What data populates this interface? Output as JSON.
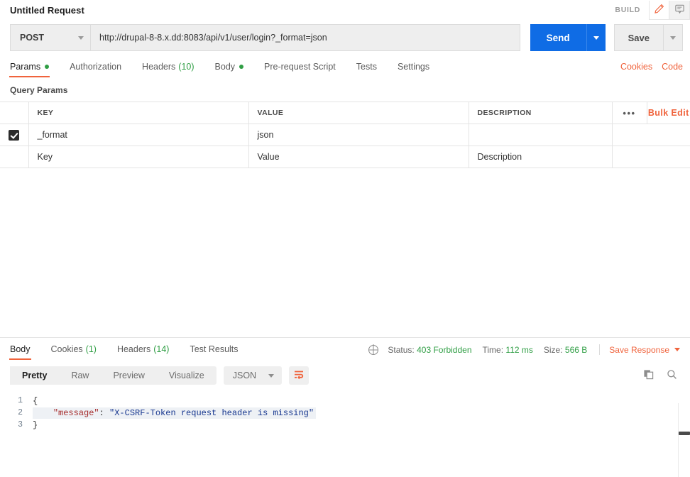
{
  "titlebar": {
    "request_title": "Untitled Request",
    "build_label": "BUILD",
    "edit_icon": "pencil-icon",
    "comment_icon": "comment-icon"
  },
  "url_bar": {
    "method": "POST",
    "url": "http://drupal-8-8.x.dd:8083/api/v1/user/login?_format=json",
    "send_label": "Send",
    "save_label": "Save"
  },
  "request_tabs": {
    "items": [
      {
        "label": "Params",
        "badge": "",
        "dot": true,
        "active": true
      },
      {
        "label": "Authorization",
        "badge": "",
        "dot": false,
        "active": false
      },
      {
        "label": "Headers",
        "badge": "(10)",
        "dot": false,
        "active": false
      },
      {
        "label": "Body",
        "badge": "",
        "dot": true,
        "active": false
      },
      {
        "label": "Pre-request Script",
        "badge": "",
        "dot": false,
        "active": false
      },
      {
        "label": "Tests",
        "badge": "",
        "dot": false,
        "active": false
      },
      {
        "label": "Settings",
        "badge": "",
        "dot": false,
        "active": false
      }
    ],
    "cookies_link": "Cookies",
    "code_link": "Code"
  },
  "query_params": {
    "section_title": "Query Params",
    "headers": {
      "key": "KEY",
      "value": "VALUE",
      "description": "DESCRIPTION",
      "more": "•••",
      "bulk_edit": "Bulk Edit"
    },
    "rows": [
      {
        "checked": true,
        "key": "_format",
        "value": "json",
        "description": "",
        "placeholder": false
      },
      {
        "checked": false,
        "key": "Key",
        "value": "Value",
        "description": "Description",
        "placeholder": true
      }
    ]
  },
  "response": {
    "tabs": [
      {
        "label": "Body",
        "badge": "",
        "active": true
      },
      {
        "label": "Cookies",
        "badge": "(1)",
        "active": false
      },
      {
        "label": "Headers",
        "badge": "(14)",
        "active": false
      },
      {
        "label": "Test Results",
        "badge": "",
        "active": false
      }
    ],
    "globe_icon": "globe-icon",
    "status_label": "Status:",
    "status_value": "403 Forbidden",
    "time_label": "Time:",
    "time_value": "112 ms",
    "size_label": "Size:",
    "size_value": "566 B",
    "save_response_label": "Save Response",
    "view_modes": [
      {
        "label": "Pretty",
        "active": true
      },
      {
        "label": "Raw",
        "active": false
      },
      {
        "label": "Preview",
        "active": false
      },
      {
        "label": "Visualize",
        "active": false
      }
    ],
    "format": "JSON",
    "wrap_icon": "word-wrap-icon",
    "copy_icon": "copy-icon",
    "search_icon": "search-icon",
    "body_lines": [
      {
        "no": "1",
        "parts": [
          {
            "t": "{",
            "c": "jpunct"
          }
        ],
        "highlight": false
      },
      {
        "no": "2",
        "parts": [
          {
            "t": "    ",
            "c": "jpunct"
          },
          {
            "t": "\"message\"",
            "c": "jkey"
          },
          {
            "t": ": ",
            "c": "jpunct"
          },
          {
            "t": "\"X-CSRF-Token request header is missing\"",
            "c": "jstr"
          }
        ],
        "highlight": true
      },
      {
        "no": "3",
        "parts": [
          {
            "t": "}",
            "c": "jpunct"
          }
        ],
        "highlight": false
      }
    ]
  },
  "colors": {
    "accent_orange": "#f0633c",
    "send_blue": "#0f6ce5",
    "status_green": "#2f9e44",
    "json_key": "#a52a2a",
    "json_string": "#16368f"
  }
}
